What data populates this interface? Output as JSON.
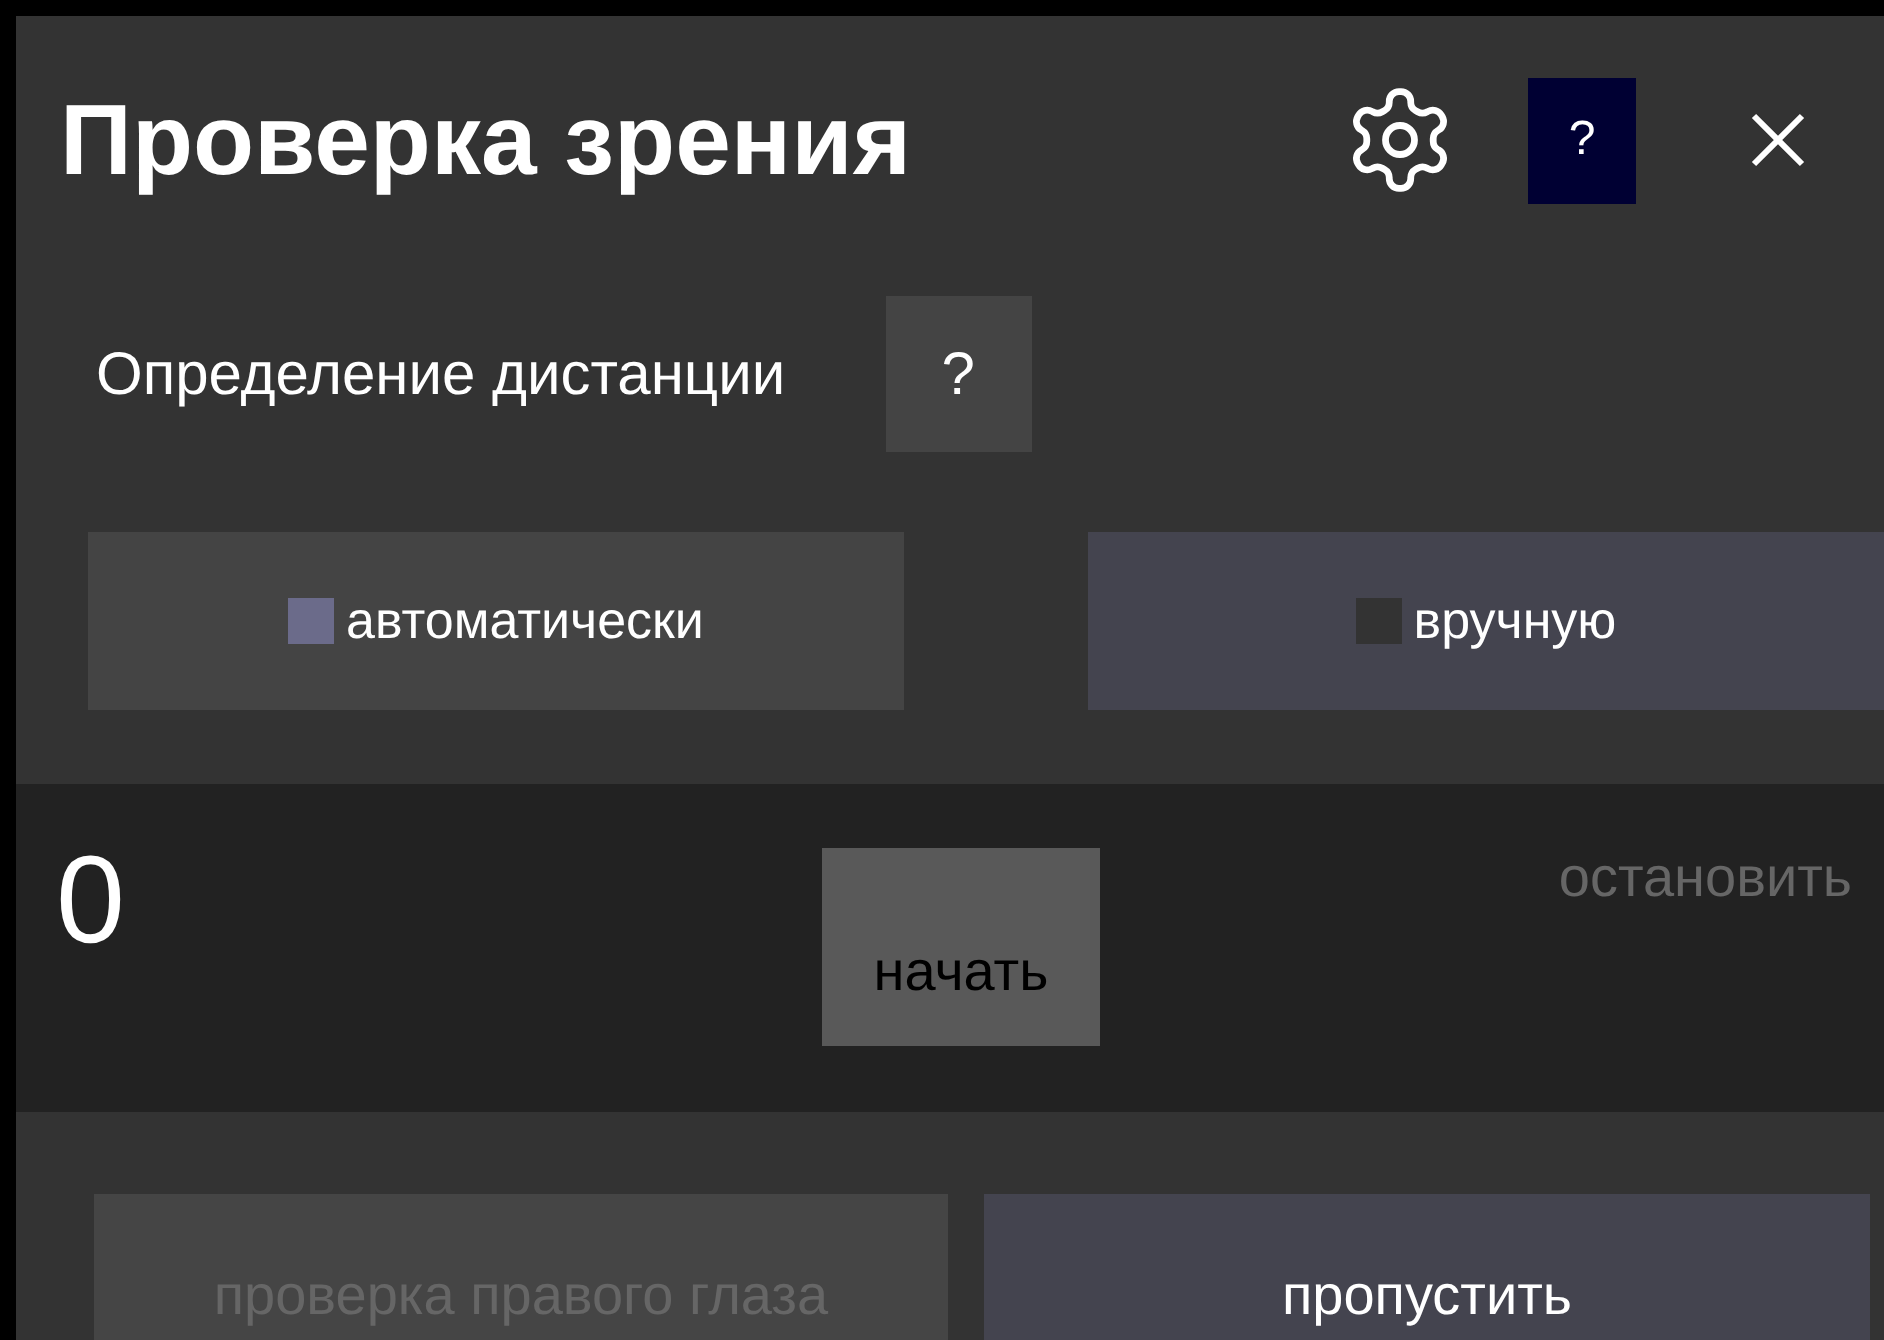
{
  "window": {
    "title": "Проверка зрения",
    "help": "?"
  },
  "distance": {
    "label": "Определение дистанции",
    "help": "?"
  },
  "modes": [
    {
      "label": "автоматически",
      "selected": true
    },
    {
      "label": "вручную",
      "selected": false
    }
  ],
  "timer": {
    "value": "0",
    "controls": [
      {
        "label": "начать",
        "disabled": false
      },
      {
        "label": "остановить",
        "disabled": true
      }
    ]
  },
  "actions": [
    {
      "label": "проверка правого глаза",
      "disabled": true
    },
    {
      "label": "пропустить",
      "disabled": false
    }
  ]
}
